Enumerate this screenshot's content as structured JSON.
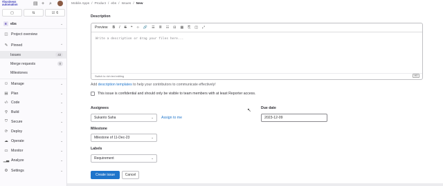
{
  "sidebar": {
    "logo_text": "#business automation",
    "top_icons": [
      "sidebar-toggle-icon",
      "plus-icon",
      "search-icon"
    ],
    "switch": [
      {
        "icon": "issues-icon",
        "count": ""
      },
      {
        "icon": "merge-request-icon",
        "count": ""
      },
      {
        "icon": "todo-icon",
        "count": "6"
      }
    ],
    "project": {
      "initial": "E",
      "name": "ebs"
    },
    "items": [
      {
        "label": "Project overview",
        "icon": "project-icon"
      },
      {
        "label": "Pinned",
        "icon": "pin-icon"
      },
      {
        "label": "Issues",
        "count": "43"
      },
      {
        "label": "Merge requests",
        "count": "0"
      },
      {
        "label": "Milestones"
      },
      {
        "label": "Manage",
        "icon": "users-icon"
      },
      {
        "label": "Plan",
        "icon": "plan-icon"
      },
      {
        "label": "Code",
        "icon": "code-icon"
      },
      {
        "label": "Build",
        "icon": "rocket-icon"
      },
      {
        "label": "Secure",
        "icon": "shield-icon"
      },
      {
        "label": "Deploy",
        "icon": "deploy-icon"
      },
      {
        "label": "Operate",
        "icon": "cloud-icon"
      },
      {
        "label": "Monitor",
        "icon": "monitor-icon"
      },
      {
        "label": "Analyze",
        "icon": "chart-icon"
      },
      {
        "label": "Settings",
        "icon": "gear-icon"
      }
    ]
  },
  "breadcrumb": [
    "Mobile Apps",
    "Product",
    "ebs",
    "Issues",
    "New"
  ],
  "description": {
    "label": "Description",
    "toolbar_preview": "Preview",
    "placeholder": "Write a description or drag your files here...",
    "footer": "Switch to rich text editing",
    "md_badge": "MD"
  },
  "templates": {
    "prefix": "Add ",
    "link": "description templates",
    "suffix": " to help your contributors to communicate effectively!"
  },
  "confidential": "This issue is confidential and should only be visible to team members with at least Reporter access.",
  "assignees": {
    "label": "Assignees",
    "value": "Sukanto Saha",
    "assign_to_me": "Assign to me"
  },
  "due_date": {
    "label": "Due date",
    "value": "2023-12-09"
  },
  "milestone": {
    "label": "Milestone",
    "value": "Milestone of 11-Dec-23"
  },
  "labels": {
    "label": "Labels",
    "value": "Requirement"
  },
  "actions": {
    "create": "Create issue",
    "cancel": "Cancel"
  }
}
